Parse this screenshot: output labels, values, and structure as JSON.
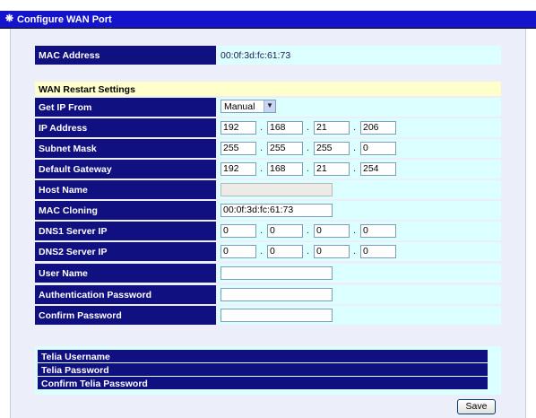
{
  "window": {
    "title": "Configure WAN Port"
  },
  "mac": {
    "label": "MAC Address",
    "value": "00:0f:3d:fc:61:73"
  },
  "restart": {
    "heading": "WAN Restart Settings",
    "get_ip_from": {
      "label": "Get IP From",
      "selected": "Manual"
    },
    "ip_address": {
      "label": "IP Address",
      "octets": [
        "192",
        "168",
        "21",
        "206"
      ]
    },
    "subnet_mask": {
      "label": "Subnet Mask",
      "octets": [
        "255",
        "255",
        "255",
        "0"
      ]
    },
    "default_gateway": {
      "label": "Default Gateway",
      "octets": [
        "192",
        "168",
        "21",
        "254"
      ]
    },
    "host_name": {
      "label": "Host Name",
      "value": ""
    },
    "mac_cloning": {
      "label": "MAC Cloning",
      "value": "00:0f:3d:fc:61:73"
    },
    "dns1": {
      "label": "DNS1 Server IP",
      "octets": [
        "0",
        "0",
        "0",
        "0"
      ]
    },
    "dns2": {
      "label": "DNS2 Server IP",
      "octets": [
        "0",
        "0",
        "0",
        "0"
      ]
    },
    "user_name": {
      "label": "User Name",
      "value": ""
    },
    "auth_password": {
      "label": "Authentication Password",
      "value": ""
    },
    "confirm_password": {
      "label": "Confirm Password",
      "value": ""
    }
  },
  "telia": {
    "username_label": "Telia Username",
    "password_label": "Telia Password",
    "confirm_label": "Confirm Telia Password"
  },
  "actions": {
    "save_label": "Save"
  },
  "icons": {
    "title_icon": "network-icon",
    "dropdown_icon": "chevron-down-icon"
  }
}
